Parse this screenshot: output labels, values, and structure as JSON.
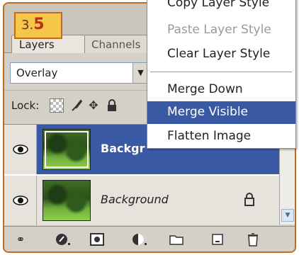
{
  "badge": {
    "prefix": "3.",
    "number": "5"
  },
  "tabs": [
    {
      "label": "Layers",
      "active": true
    },
    {
      "label": "Channels",
      "active": false
    }
  ],
  "blend_mode": {
    "value": "Overlay"
  },
  "lock": {
    "label": "Lock:",
    "icons": [
      "lock-transparent-pixels-icon",
      "lock-image-pixels-icon",
      "lock-position-icon",
      "lock-all-icon"
    ]
  },
  "layers": [
    {
      "name": "Backgr",
      "selected": true,
      "visible": true
    },
    {
      "name": "Background",
      "selected": false,
      "visible": true,
      "locked": true
    }
  ],
  "bottom_toolbar": {
    "icons": [
      "link-icon",
      "layer-style-icon",
      "layer-mask-icon",
      "adjustment-layer-icon",
      "new-group-icon",
      "new-layer-icon",
      "trash-icon"
    ]
  },
  "context_menu": {
    "items": [
      {
        "label": "Copy Layer Style",
        "state": "partial"
      },
      {
        "label": "Paste Layer Style",
        "state": "disabled"
      },
      {
        "label": "Clear Layer Style",
        "state": "normal"
      },
      {
        "label": "Merge Down",
        "state": "normal"
      },
      {
        "label": "Merge Visible",
        "state": "highlighted"
      },
      {
        "label": "Flatten Image",
        "state": "normal"
      }
    ]
  },
  "colors": {
    "selection": "#3a59a5",
    "frame_border": "#c46a1c",
    "badge_fill": "#f6c64b",
    "badge_number": "#b33412"
  }
}
